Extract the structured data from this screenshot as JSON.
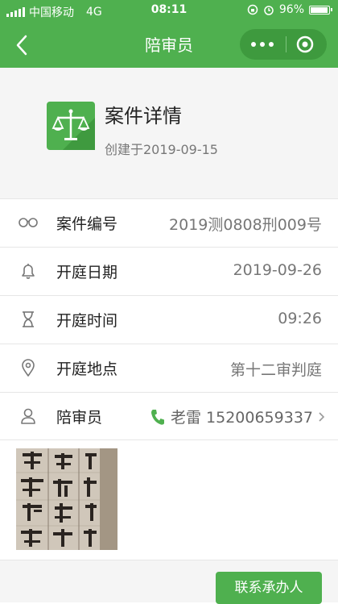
{
  "status_bar": {
    "carrier": "中国移动",
    "network": "4G",
    "time": "08:11",
    "battery": "96%"
  },
  "nav": {
    "title": "陪审员"
  },
  "case": {
    "title": "案件详情",
    "created": "创建于2019-09-15",
    "icon": "scales-icon"
  },
  "details": [
    {
      "icon": "glasses-icon",
      "label": "案件编号",
      "value": "2019测0808刑009号"
    },
    {
      "icon": "bell-icon",
      "label": "开庭日期",
      "value": "2019-09-26"
    },
    {
      "icon": "hourglass-icon",
      "label": "开庭时间",
      "value": "09:26"
    },
    {
      "icon": "location-icon",
      "label": "开庭地点",
      "value": "第十二审判庭"
    },
    {
      "icon": "person-icon",
      "label": "陪审员",
      "value": "老雷 15200659337"
    }
  ],
  "actions": {
    "contact_button": "联系承办人"
  },
  "colors": {
    "brand_green": "#4fb04f",
    "capsule_green": "#3e9a3e",
    "text_gray": "#777777"
  }
}
